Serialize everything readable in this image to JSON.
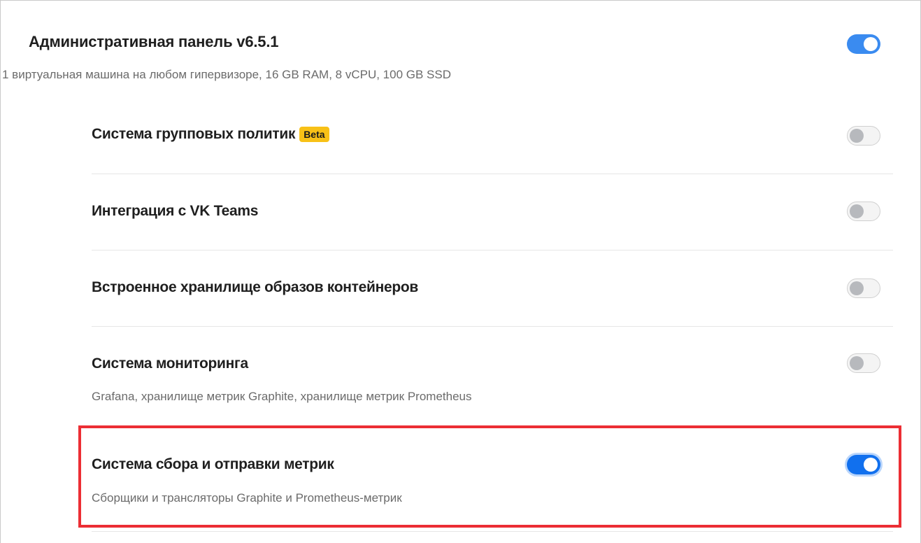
{
  "main": {
    "title": "Административная панель v6.5.1",
    "description": "1 виртуальная машина на любом гипервизоре, 16 GB RAM, 8 vCPU, 100 GB SSD",
    "enabled": true
  },
  "components": [
    {
      "title": "Система групповых политик",
      "badge": "Beta",
      "description": "",
      "enabled": false
    },
    {
      "title": "Интеграция с VK Teams",
      "description": "",
      "enabled": false
    },
    {
      "title": "Встроенное хранилище образов контейнеров",
      "description": "",
      "enabled": false
    },
    {
      "title": "Система мониторинга",
      "description": "Grafana, хранилище метрик Graphite, хранилище метрик Prometheus",
      "enabled": false
    },
    {
      "title": "Система сбора и отправки метрик",
      "description": "Сборщики и трансляторы Graphite и Prometheus-метрик",
      "enabled": true,
      "highlighted": true
    }
  ],
  "colors": {
    "toggle_on": "#3a8bf0",
    "toggle_focus": "#1170ee",
    "badge": "#f8c117",
    "highlight_border": "#ec2e34"
  }
}
